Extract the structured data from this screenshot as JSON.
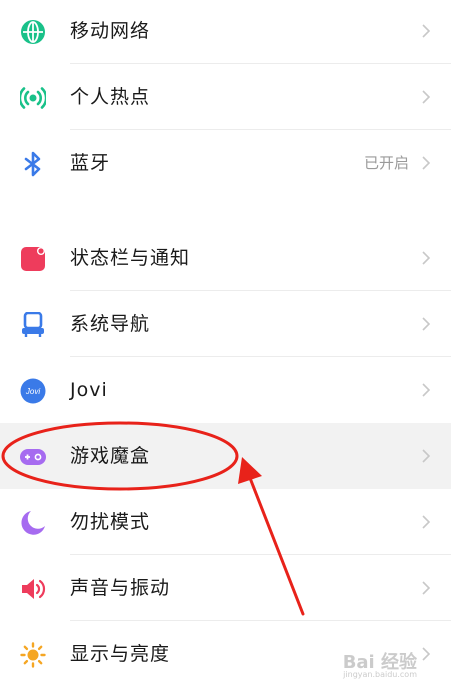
{
  "settings": {
    "items": [
      {
        "label": "移动网络",
        "icon": "globe-icon",
        "color": "#19c189"
      },
      {
        "label": "个人热点",
        "icon": "hotspot-icon",
        "color": "#19c189"
      },
      {
        "label": "蓝牙",
        "icon": "bluetooth-icon",
        "color": "#3a7ae8",
        "status": "已开启"
      },
      {
        "label": "状态栏与通知",
        "icon": "notification-icon",
        "color": "#ee3c5c"
      },
      {
        "label": "系统导航",
        "icon": "navigation-icon",
        "color": "#3a7ae8"
      },
      {
        "label": "Jovi",
        "icon": "jovi-icon",
        "color": "#3a7ae8",
        "icon_text": "Jovi"
      },
      {
        "label": "游戏魔盒",
        "icon": "gamepad-icon",
        "color": "#a66bf0",
        "highlighted": true
      },
      {
        "label": "勿扰模式",
        "icon": "moon-icon",
        "color": "#a66bf0"
      },
      {
        "label": "声音与振动",
        "icon": "speaker-icon",
        "color": "#ee3c5c"
      },
      {
        "label": "显示与亮度",
        "icon": "sun-icon",
        "color": "#f5a623"
      }
    ]
  },
  "annotation_color": "#e8221a",
  "watermark": {
    "text": "Bai 经验",
    "sub": "jingyan.baidu.com"
  }
}
